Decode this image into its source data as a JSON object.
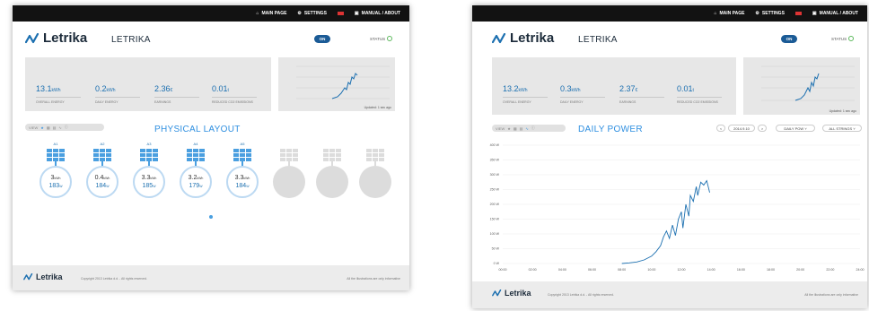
{
  "nav": {
    "main_page": "MAIN PAGE",
    "main_page_right": "MAIN PAGE",
    "settings": "SETTINGS",
    "manual": "MANUAL / ABOUT"
  },
  "app": {
    "brand": "Letrika",
    "subtitle": "LETRIKA",
    "on_label": "ON",
    "status_label": "STATUS"
  },
  "left": {
    "stats": [
      {
        "value": "13.1",
        "unit": "kWh",
        "label": "OVERALL ENERGY"
      },
      {
        "value": "0.2",
        "unit": "kWh",
        "label": "DAILY ENERGY"
      },
      {
        "value": "2.36",
        "unit": "€",
        "label": "EARNINGS"
      },
      {
        "value": "0.01",
        "unit": "t",
        "label": "REDUCED CO2 EMISSIONS"
      }
    ],
    "mini_chart": {
      "updated": "Updated: 1 sec ago"
    },
    "view_label": "VIEW",
    "section_title": "PHYSICAL LAYOUT",
    "inverters": [
      {
        "label": "A1",
        "kwh": "3",
        "w": "183"
      },
      {
        "label": "A2",
        "kwh": "0.4",
        "w": "184"
      },
      {
        "label": "A3",
        "kwh": "3.3",
        "w": "185"
      },
      {
        "label": "A4",
        "kwh": "3.2",
        "w": "179"
      },
      {
        "label": "A5",
        "kwh": "3.3",
        "w": "184"
      }
    ],
    "kwh_unit": "kWh",
    "w_unit": "W"
  },
  "right": {
    "stats": [
      {
        "value": "13.2",
        "unit": "kWh",
        "label": "OVERALL ENERGY"
      },
      {
        "value": "0.3",
        "unit": "kWh",
        "label": "DAILY ENERGY"
      },
      {
        "value": "2.37",
        "unit": "€",
        "label": "EARNINGS"
      },
      {
        "value": "0.01",
        "unit": "t",
        "label": "REDUCED CO2 EMISSIONS"
      }
    ],
    "mini_chart": {
      "updated": "Updated: 1 sec ago"
    },
    "view_label": "VIEW",
    "section_title": "DAILY POWER",
    "date": "2014.9.10",
    "prev": "<",
    "next": ">",
    "select_type": "DAILY POW",
    "select_strings": "ALL STRINGS"
  },
  "footer": {
    "copyright": "Copyright 2013 Letrika d.d. - All rights reserved.",
    "rights": "All the illustrations are only informative"
  },
  "colors": {
    "accent": "#2f8fe0",
    "brand": "#1b5b96",
    "topbar": "#121212"
  },
  "chart_data": {
    "type": "line",
    "title": "DAILY POWER",
    "y_ticks": [
      "400 W",
      "350 W",
      "300 W",
      "250 W",
      "200 W",
      "150 W",
      "100 W",
      "50 W",
      "0 W"
    ],
    "x_ticks": [
      "00:00",
      "02:00",
      "04:00",
      "06:00",
      "08:00",
      "10:00",
      "12:00",
      "14:00",
      "16:00",
      "18:00",
      "20:00",
      "22:00",
      "24:00"
    ],
    "ylim": [
      0,
      400
    ],
    "xlim": [
      0,
      24
    ],
    "grid": true,
    "series": [
      {
        "points": [
          [
            8.0,
            0
          ],
          [
            8.5,
            2
          ],
          [
            9.0,
            5
          ],
          [
            9.5,
            12
          ],
          [
            10.0,
            25
          ],
          [
            10.3,
            40
          ],
          [
            10.6,
            60
          ],
          [
            10.8,
            90
          ],
          [
            11.0,
            110
          ],
          [
            11.2,
            85
          ],
          [
            11.4,
            130
          ],
          [
            11.6,
            95
          ],
          [
            11.8,
            150
          ],
          [
            12.0,
            175
          ],
          [
            12.1,
            120
          ],
          [
            12.3,
            200
          ],
          [
            12.5,
            160
          ],
          [
            12.6,
            230
          ],
          [
            12.8,
            210
          ],
          [
            13.0,
            260
          ],
          [
            13.1,
            230
          ],
          [
            13.3,
            275
          ],
          [
            13.5,
            265
          ],
          [
            13.7,
            280
          ],
          [
            13.8,
            260
          ],
          [
            13.9,
            240
          ]
        ]
      }
    ]
  }
}
